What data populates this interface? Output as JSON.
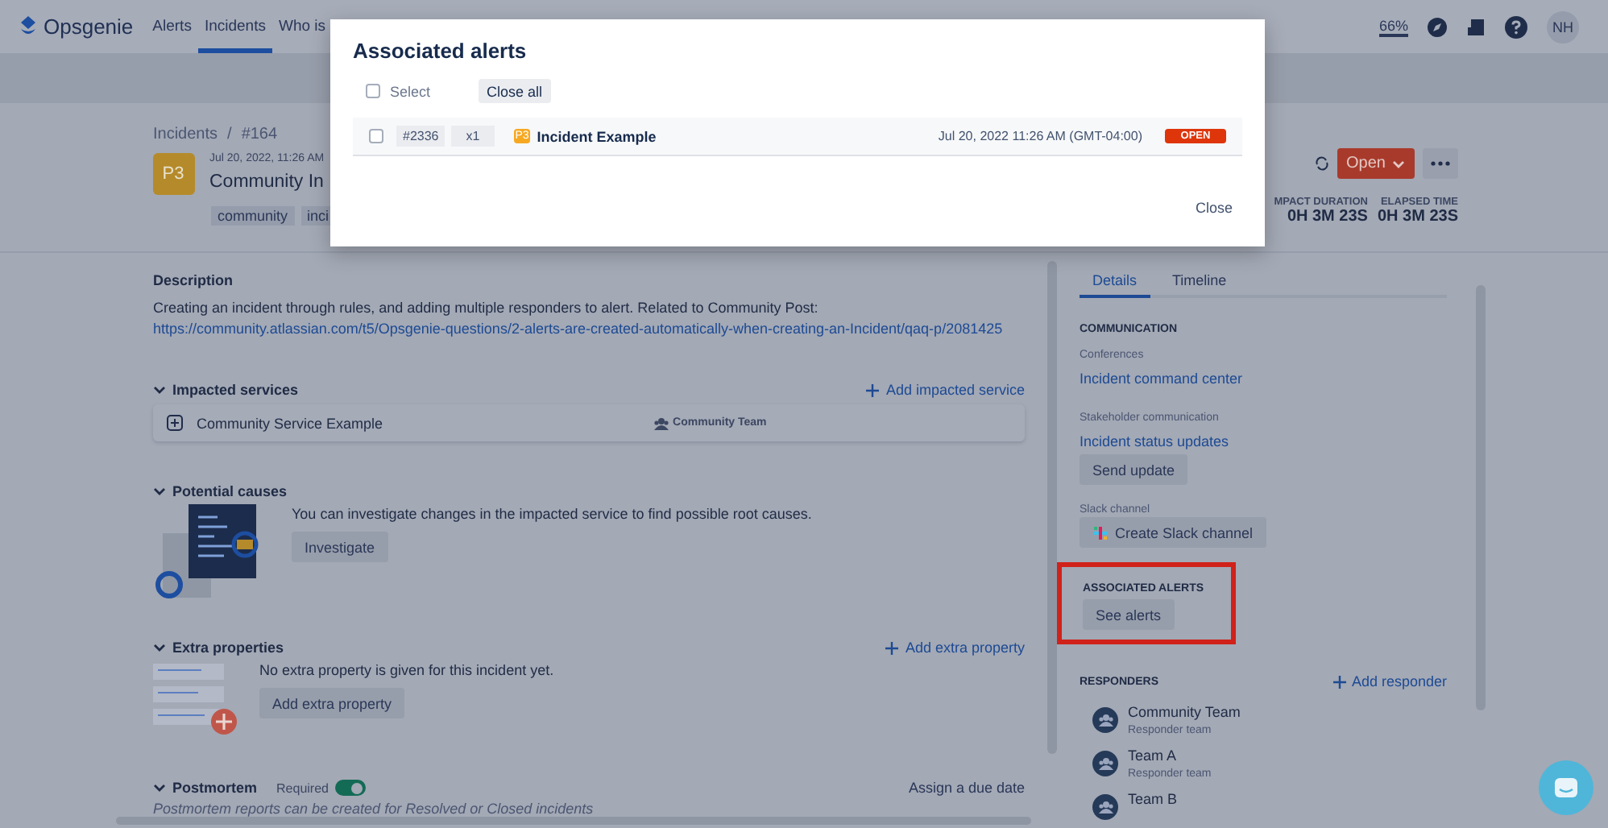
{
  "nav": {
    "logo": "Opsgenie",
    "items": [
      {
        "label": "Alerts",
        "selected": false
      },
      {
        "label": "Incidents",
        "selected": true
      },
      {
        "label": "Who is",
        "selected": false
      }
    ],
    "zoom": "66%",
    "avatar": "NH"
  },
  "incident": {
    "breadcrumb": [
      "Incidents",
      "#164"
    ],
    "breadcrumb_separator": "/",
    "priority": "P3",
    "date": "Jul 20, 2022, 11:26 AM",
    "title": "Community In",
    "tags": [
      "community",
      "inci"
    ],
    "status_button": "Open",
    "metrics": [
      {
        "label": "MPACT DURATION",
        "value": "0H 3M 23S"
      },
      {
        "label": "ELAPSED TIME",
        "value": "0H 3M 23S"
      }
    ]
  },
  "description": {
    "heading": "Description",
    "text": "Creating an incident through rules, and adding multiple responders to alert. Related to Community Post:",
    "link": "https://community.atlassian.com/t5/Opsgenie-questions/2-alerts-are-created-automatically-when-creating-an-Incident/qaq-p/2081425"
  },
  "impacted_services": {
    "heading": "Impacted services",
    "expanded": true,
    "action": "Add impacted service",
    "services": [
      {
        "name": "Community Service Example",
        "team": "Community Team"
      }
    ]
  },
  "potential_causes": {
    "heading": "Potential causes",
    "expanded": true,
    "text": "You can investigate changes in the impacted service to find possible root causes.",
    "button": "Investigate"
  },
  "extra_properties": {
    "heading": "Extra properties",
    "expanded": true,
    "action": "Add extra property",
    "text": "No extra property is given for this incident yet.",
    "button": "Add extra property"
  },
  "postmortem": {
    "heading": "Postmortem",
    "expanded": true,
    "required_label": "Required",
    "required": true,
    "action": "Assign a due date",
    "note": "Postmortem reports can be created for Resolved or Closed incidents"
  },
  "details_panel": {
    "tabs": [
      {
        "label": "Details",
        "selected": true
      },
      {
        "label": "Timeline",
        "selected": false
      }
    ],
    "communication": {
      "heading": "COMMUNICATION",
      "conferences_label": "Conferences",
      "conference_link": "Incident command center",
      "stakeholder_label": "Stakeholder communication",
      "stakeholder_link": "Incident status updates",
      "send_button": "Send update",
      "slack_label": "Slack channel",
      "slack_button": "Create Slack channel"
    },
    "associated_alerts": {
      "heading": "ASSOCIATED ALERTS",
      "button": "See alerts",
      "highlighted": true
    },
    "responders": {
      "heading": "RESPONDERS",
      "action": "Add responder",
      "items": [
        {
          "name": "Community Team",
          "role": "Responder team"
        },
        {
          "name": "Team A",
          "role": "Responder team"
        },
        {
          "name": "Team B"
        }
      ]
    }
  },
  "modal": {
    "title": "Associated alerts",
    "select_label": "Select",
    "select_checked": false,
    "close_all": "Close all",
    "alerts": [
      {
        "checked": false,
        "id": "#2336",
        "count": "x1",
        "priority": "P3",
        "title": "Incident Example",
        "date": "Jul 20, 2022 11:26 AM (GMT-04:00)",
        "status": "OPEN"
      }
    ],
    "close": "Close"
  }
}
